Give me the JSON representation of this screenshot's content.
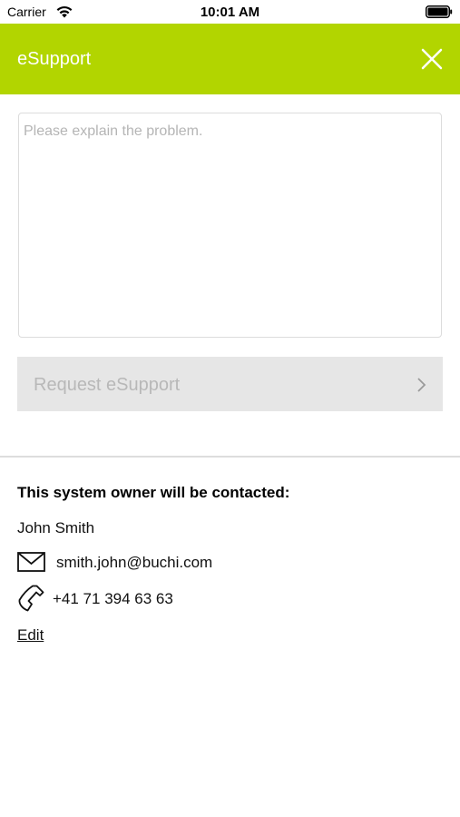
{
  "status_bar": {
    "carrier": "Carrier",
    "time": "10:01 AM"
  },
  "header": {
    "title": "eSupport",
    "background_color": "#b2d500"
  },
  "problem_input": {
    "placeholder": "Please explain the problem.",
    "value": ""
  },
  "request_button": {
    "label": "Request eSupport"
  },
  "contact": {
    "heading": "This system owner will be contacted:",
    "name": "John Smith",
    "email": "smith.john@buchi.com",
    "phone": "+41 71 394 63 63",
    "edit_label": "Edit"
  },
  "icons": {
    "wifi": "wifi-icon",
    "battery": "battery-icon",
    "close": "close-icon",
    "chevron": "chevron-right-icon",
    "mail": "mail-icon",
    "phone": "phone-icon"
  }
}
